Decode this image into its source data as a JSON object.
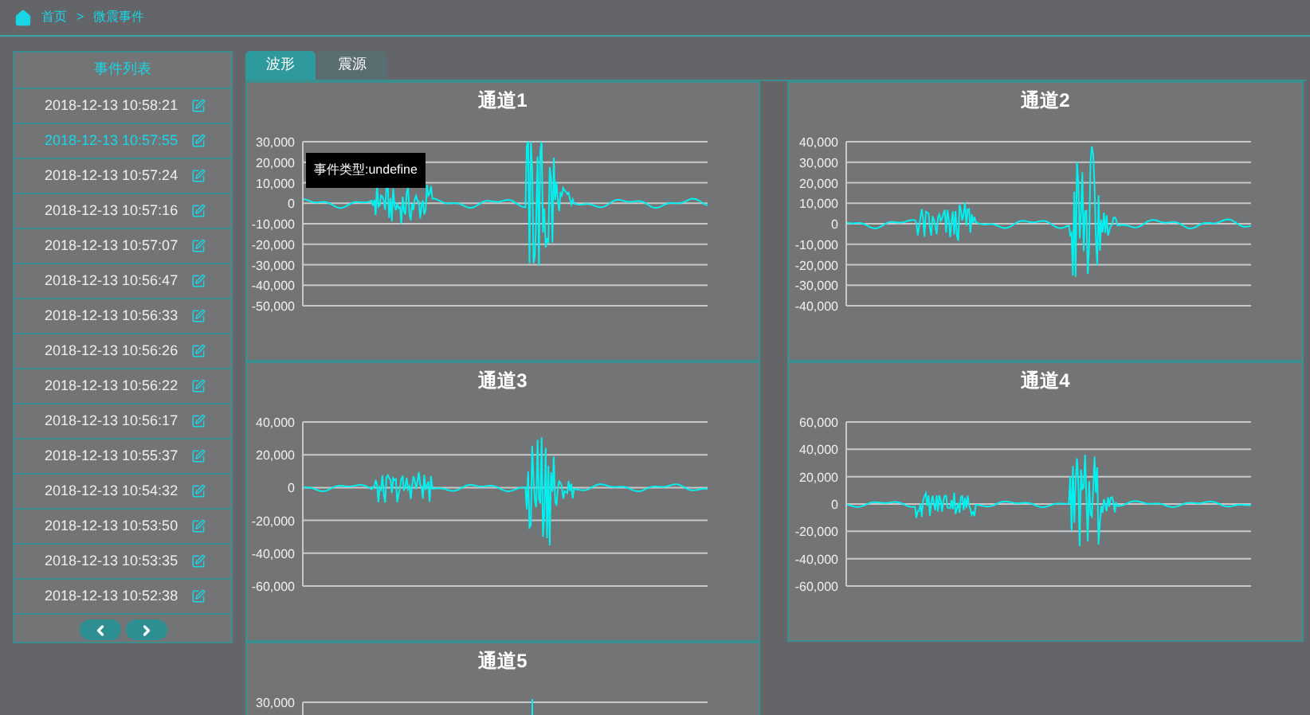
{
  "breadcrumb": {
    "items": [
      {
        "label": "首页"
      },
      {
        "label": "微震事件"
      }
    ],
    "separator": ">"
  },
  "event_list": {
    "title": "事件列表",
    "items": [
      {
        "time": "2018-12-13 10:58:21",
        "selected": false
      },
      {
        "time": "2018-12-13 10:57:55",
        "selected": true
      },
      {
        "time": "2018-12-13 10:57:24",
        "selected": false
      },
      {
        "time": "2018-12-13 10:57:16",
        "selected": false
      },
      {
        "time": "2018-12-13 10:57:07",
        "selected": false
      },
      {
        "time": "2018-12-13 10:56:47",
        "selected": false
      },
      {
        "time": "2018-12-13 10:56:33",
        "selected": false
      },
      {
        "time": "2018-12-13 10:56:26",
        "selected": false
      },
      {
        "time": "2018-12-13 10:56:22",
        "selected": false
      },
      {
        "time": "2018-12-13 10:56:17",
        "selected": false
      },
      {
        "time": "2018-12-13 10:55:37",
        "selected": false
      },
      {
        "time": "2018-12-13 10:54:32",
        "selected": false
      },
      {
        "time": "2018-12-13 10:53:50",
        "selected": false
      },
      {
        "time": "2018-12-13 10:53:35",
        "selected": false
      },
      {
        "time": "2018-12-13 10:52:38",
        "selected": false
      }
    ]
  },
  "tooltip": {
    "text": "事件类型:undefine"
  },
  "tabs": [
    {
      "label": "波形",
      "selected": true
    },
    {
      "label": "震源",
      "selected": false
    }
  ],
  "channels": [
    {
      "title": "通道1",
      "y_ticks": [
        "30,000",
        "20,000",
        "10,000",
        "0",
        "-10,000",
        "-20,000",
        "-30,000",
        "-40,000",
        "-50,000"
      ]
    },
    {
      "title": "通道2",
      "y_ticks": [
        "40,000",
        "30,000",
        "20,000",
        "10,000",
        "0",
        "-10,000",
        "-20,000",
        "-30,000",
        "-40,000"
      ]
    },
    {
      "title": "通道3",
      "y_ticks": [
        "40,000",
        "20,000",
        "0",
        "-20,000",
        "-40,000",
        "-60,000"
      ]
    },
    {
      "title": "通道4",
      "y_ticks": [
        "60,000",
        "40,000",
        "20,000",
        "0",
        "-20,000",
        "-40,000",
        "-60,000"
      ]
    },
    {
      "title": "通道5",
      "y_ticks": [
        "30,000"
      ]
    }
  ]
}
